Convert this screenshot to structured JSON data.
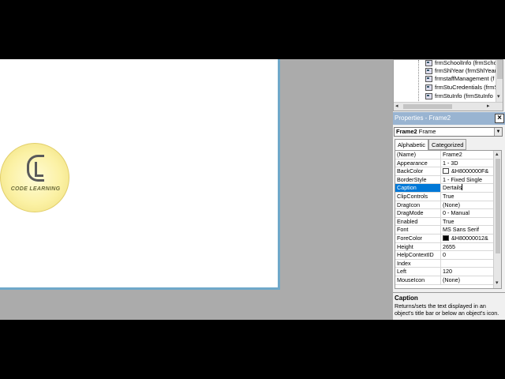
{
  "logo": {
    "text": "CODE LEARNING"
  },
  "project_explorer": {
    "items": [
      "frmSchoolInfo (frmScho",
      "frmShlYear (frmShlYear",
      "frmstaffManagement (f",
      "frmStuCredentials (frmS",
      "frmStuInfo (frmStuInfo"
    ]
  },
  "properties": {
    "title": "Properties - Frame2",
    "close_glyph": "×",
    "object_name": "Frame2",
    "object_type": "Frame",
    "tabs": {
      "alphabetic": "Alphabetic",
      "categorized": "Categorized"
    },
    "rows": [
      {
        "name": "(Name)",
        "value": "Frame2"
      },
      {
        "name": "Appearance",
        "value": "1 - 3D"
      },
      {
        "name": "BackColor",
        "value": "&H8000000F&",
        "swatch": "#ffffff"
      },
      {
        "name": "BorderStyle",
        "value": "1 - Fixed Single"
      },
      {
        "name": "Caption",
        "value": "Dertails",
        "selected": true
      },
      {
        "name": "ClipControls",
        "value": "True"
      },
      {
        "name": "DragIcon",
        "value": "(None)"
      },
      {
        "name": "DragMode",
        "value": "0 - Manual"
      },
      {
        "name": "Enabled",
        "value": "True"
      },
      {
        "name": "Font",
        "value": "MS Sans Serif"
      },
      {
        "name": "ForeColor",
        "value": "&H80000012&",
        "swatch": "#000000"
      },
      {
        "name": "Height",
        "value": "2655"
      },
      {
        "name": "HelpContextID",
        "value": "0"
      },
      {
        "name": "Index",
        "value": ""
      },
      {
        "name": "Left",
        "value": "120"
      },
      {
        "name": "MouseIcon",
        "value": "(None)"
      }
    ]
  },
  "description": {
    "title": "Caption",
    "text": "Returns/sets the text displayed in an object's title bar or below an object's icon."
  }
}
